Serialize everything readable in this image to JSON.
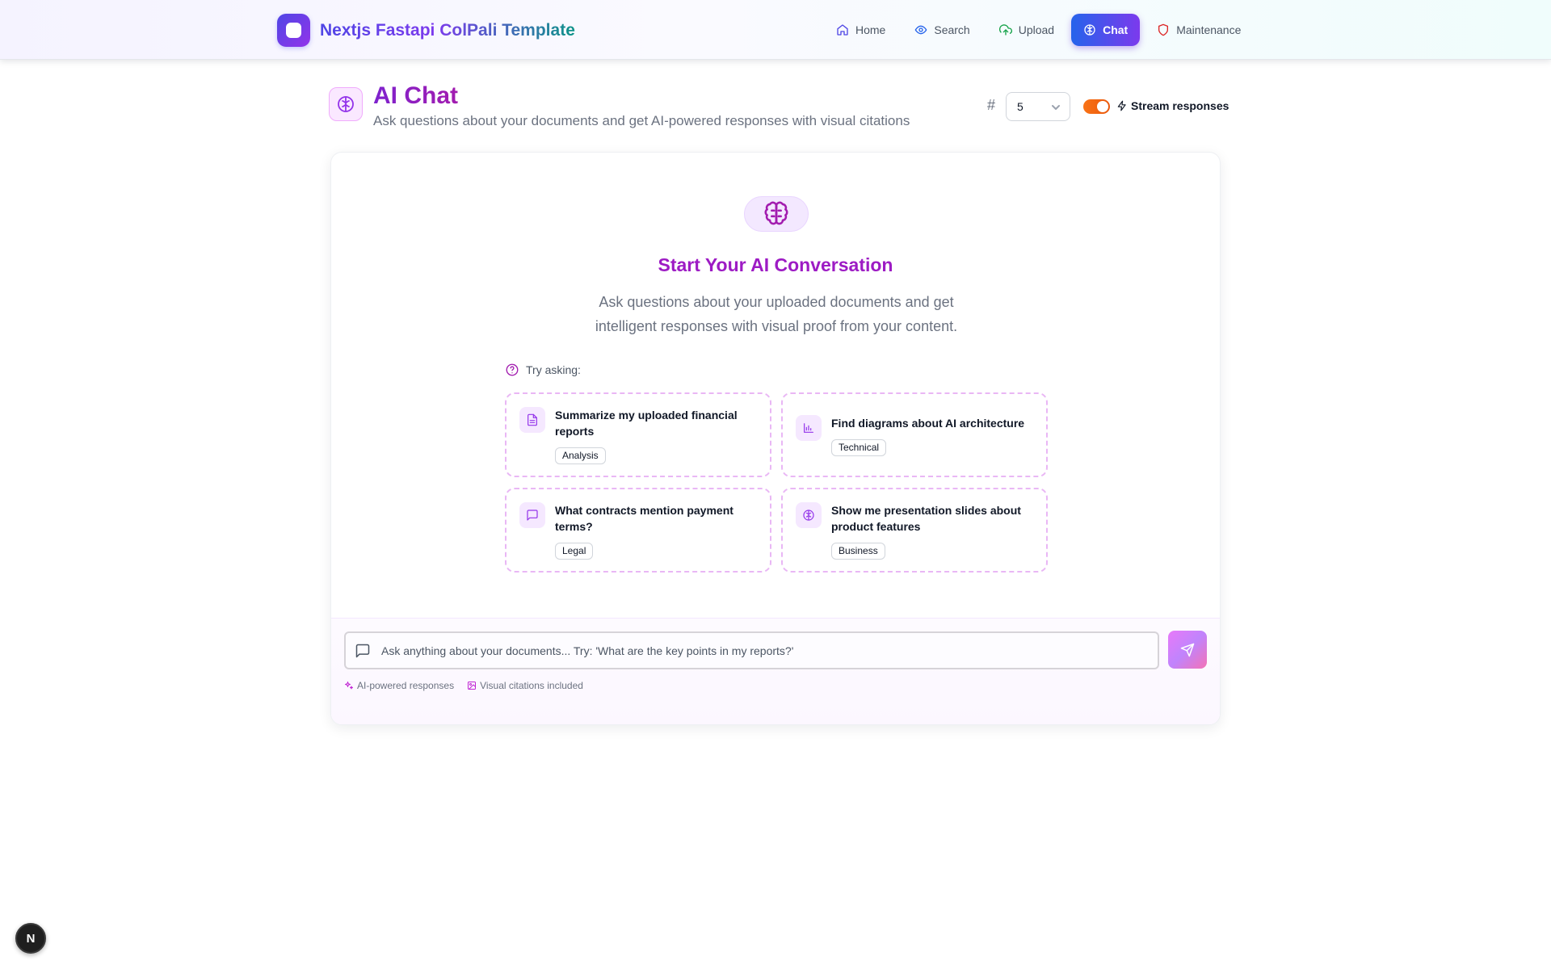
{
  "app": {
    "title": "Nextjs Fastapi ColPali Template"
  },
  "nav": {
    "items": [
      {
        "label": "Home",
        "icon": "home-icon",
        "active": false
      },
      {
        "label": "Search",
        "icon": "eye-icon",
        "active": false
      },
      {
        "label": "Upload",
        "icon": "cloud-upload-icon",
        "active": false
      },
      {
        "label": "Chat",
        "icon": "brain-icon",
        "active": true
      },
      {
        "label": "Maintenance",
        "icon": "shield-icon",
        "active": false
      }
    ]
  },
  "header": {
    "title": "AI Chat",
    "subtitle": "Ask questions about your documents and get AI-powered responses with visual citations",
    "hash_symbol": "#",
    "result_count": "5",
    "stream_enabled": true,
    "stream_label": "Stream responses"
  },
  "empty_state": {
    "title": "Start Your AI Conversation",
    "description": "Ask questions about your uploaded documents and get intelligent responses with visual proof from your content.",
    "try_label": "Try asking:",
    "suggestions": [
      {
        "text": "Summarize my uploaded financial reports",
        "tag": "Analysis",
        "icon": "document-icon"
      },
      {
        "text": "Find diagrams about AI architecture",
        "tag": "Technical",
        "icon": "bar-chart-icon"
      },
      {
        "text": "What contracts mention payment terms?",
        "tag": "Legal",
        "icon": "message-icon"
      },
      {
        "text": "Show me presentation slides about product features",
        "tag": "Business",
        "icon": "brain-icon"
      }
    ]
  },
  "input": {
    "placeholder": "Ask anything about your documents... Try: 'What are the key points in my reports?'",
    "value": ""
  },
  "hints": [
    {
      "label": "AI-powered responses",
      "icon": "sparkles-icon"
    },
    {
      "label": "Visual citations included",
      "icon": "image-icon"
    }
  ],
  "badge": {
    "label": "N"
  },
  "colors": {
    "accent": "#9333ea",
    "nav_active_start": "#2563eb",
    "nav_active_end": "#7c3aed",
    "toggle_on": "#f97316",
    "title_purple": "#9d1bc4"
  }
}
